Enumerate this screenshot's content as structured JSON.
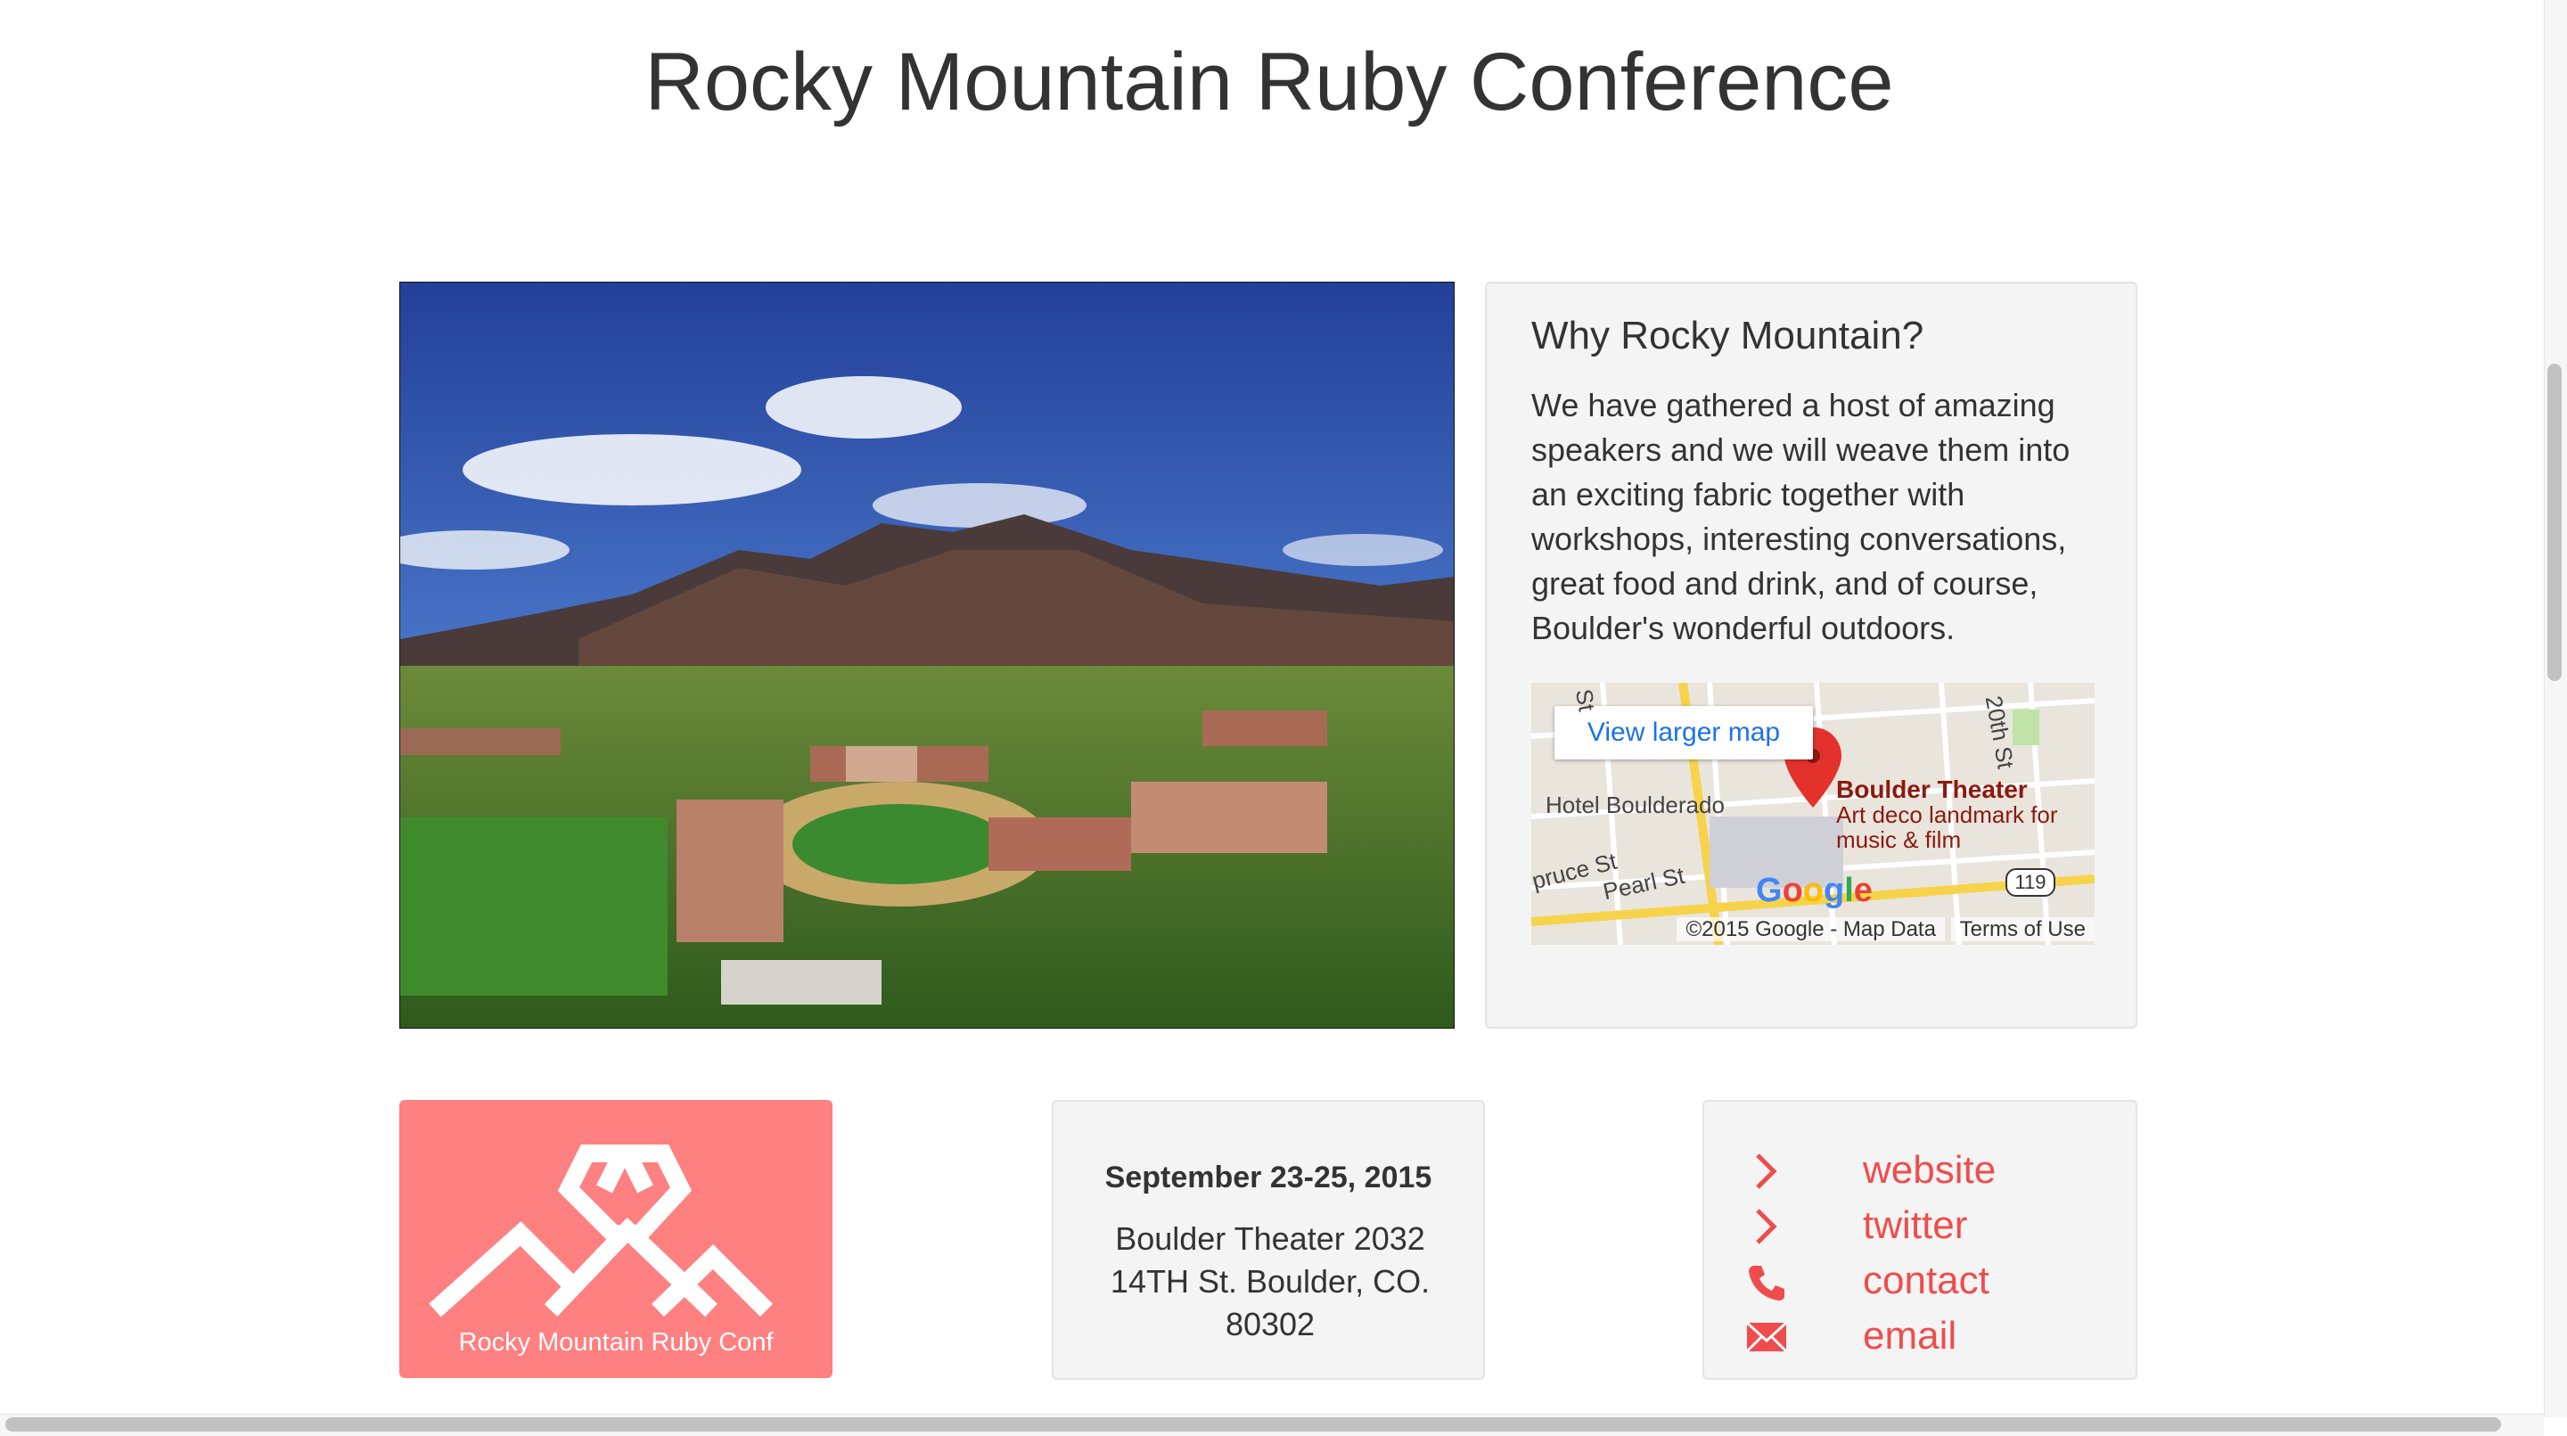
{
  "page": {
    "title": "Rocky Mountain Ruby Conference"
  },
  "why": {
    "heading": "Why Rocky Mountain?",
    "body": "We have gathered a host of amazing speakers and we will weave them into an exciting fabric together with workshops, interesting conversations, great food and drink, and of course, Boulder's wonderful outdoors."
  },
  "map": {
    "button": "View larger map",
    "hotel": "Hotel Boulderado",
    "street_spruce": "pruce St",
    "street_pearl": "Pearl St",
    "street_20th": "20th St",
    "street_top": "St",
    "venue_name": "Boulder Theater",
    "venue_desc": "Art deco landmark for music & film",
    "logo": "Google",
    "road_number": "119",
    "copyright": "©2015 Google - Map Data",
    "terms": "Terms of Use"
  },
  "logo": {
    "caption": "Rocky Mountain Ruby Conf"
  },
  "event": {
    "date": "September 23-25, 2015",
    "address": "Boulder Theater 2032 14TH St. Boulder, CO. 80302"
  },
  "links": [
    {
      "label": "website",
      "icon": "chevron-right-icon"
    },
    {
      "label": "twitter",
      "icon": "chevron-right-icon"
    },
    {
      "label": "contact",
      "icon": "phone-icon"
    },
    {
      "label": "email",
      "icon": "envelope-icon"
    }
  ],
  "colors": {
    "accent": "#ef4d4d",
    "logo_bg": "#ff8080",
    "panel_bg": "#f4f4f4"
  }
}
